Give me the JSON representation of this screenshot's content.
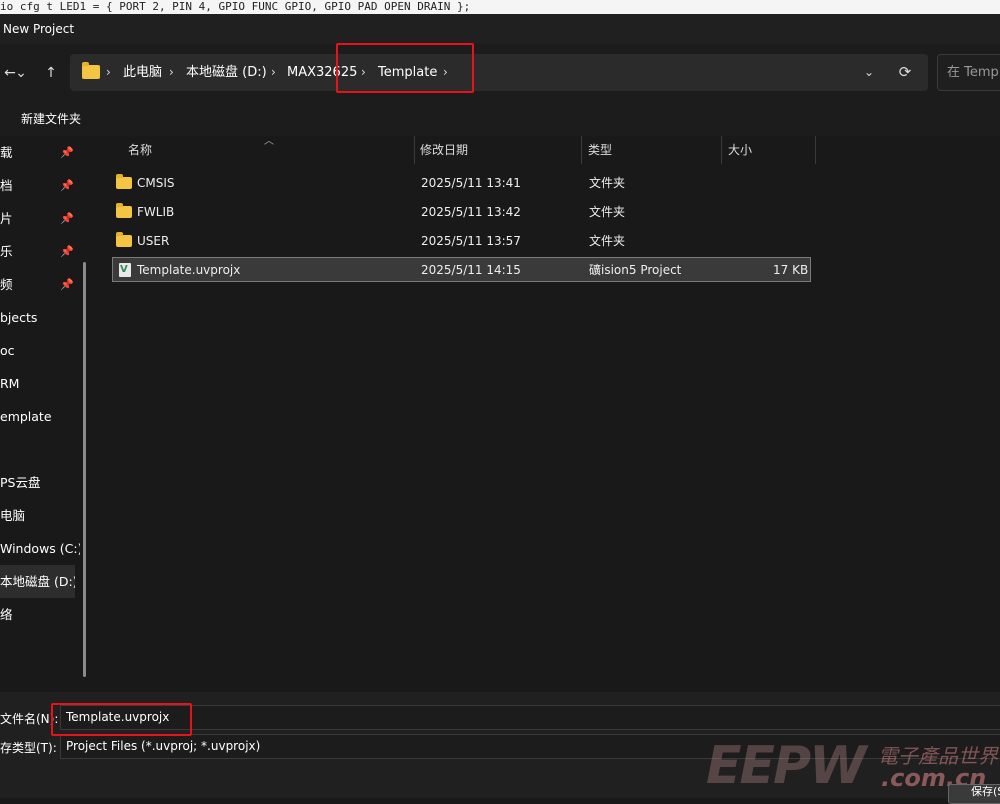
{
  "code_line": "io cfg t LED1 = { PORT 2, PIN 4, GPIO FUNC GPIO, GPIO PAD OPEN DRAIN };",
  "window_title": "New Project",
  "nav": {
    "back": "←",
    "dropdown": "⌄",
    "up": "↑"
  },
  "breadcrumb": {
    "items": [
      "此电脑",
      "本地磁盘 (D:)",
      "MAX32625",
      "Template"
    ],
    "separator": "›",
    "dropdown": "⌄",
    "refresh": "⟳"
  },
  "search": {
    "placeholder": "在 Template 中搜索"
  },
  "toolbar": {
    "new_folder": "新建文件夹"
  },
  "sidebar": {
    "quick_access": [
      {
        "label": "载",
        "pinned": true
      },
      {
        "label": "档",
        "pinned": true
      },
      {
        "label": "片",
        "pinned": true
      },
      {
        "label": "乐",
        "pinned": true
      },
      {
        "label": "频",
        "pinned": true
      },
      {
        "label": "bjects",
        "pinned": false
      },
      {
        "label": "oc",
        "pinned": false
      },
      {
        "label": "RM",
        "pinned": false
      },
      {
        "label": "emplate",
        "pinned": false
      }
    ],
    "locations": [
      {
        "label": "PS云盘"
      },
      {
        "label": "电脑"
      },
      {
        "label": "Windows (C:)"
      },
      {
        "label": "本地磁盘 (D:)",
        "selected": true
      },
      {
        "label": "络"
      }
    ],
    "pin_glyph": "📌"
  },
  "columns": {
    "name": "名称",
    "date": "修改日期",
    "type": "类型",
    "size": "大小"
  },
  "files": [
    {
      "name": "CMSIS",
      "date": "2025/5/11 13:41",
      "type": "文件夹",
      "size": "",
      "icon": "folder-icon"
    },
    {
      "name": "FWLIB",
      "date": "2025/5/11 13:42",
      "type": "文件夹",
      "size": "",
      "icon": "folder-icon"
    },
    {
      "name": "USER",
      "date": "2025/5/11 13:57",
      "type": "文件夹",
      "size": "",
      "icon": "folder-icon"
    },
    {
      "name": "Template.uvprojx",
      "date": "2025/5/11 14:15",
      "type": "礦ision5 Project",
      "size": "17 KB",
      "icon": "uvision-project-icon",
      "selected": true
    }
  ],
  "bottom": {
    "filename_label": "文件名(N):",
    "filename_value": "Template.uvprojx",
    "filetype_label": "存类型(T):",
    "filetype_value": "Project Files (*.uvproj; *.uvprojx)",
    "save_button": "保存(S)"
  },
  "watermark": {
    "big": "EEPW",
    "cn": "電子產品世界",
    "url": ".com.cn"
  },
  "colors": {
    "highlight": "#e8121a",
    "folder": "#f4c542",
    "background": "#191919"
  }
}
